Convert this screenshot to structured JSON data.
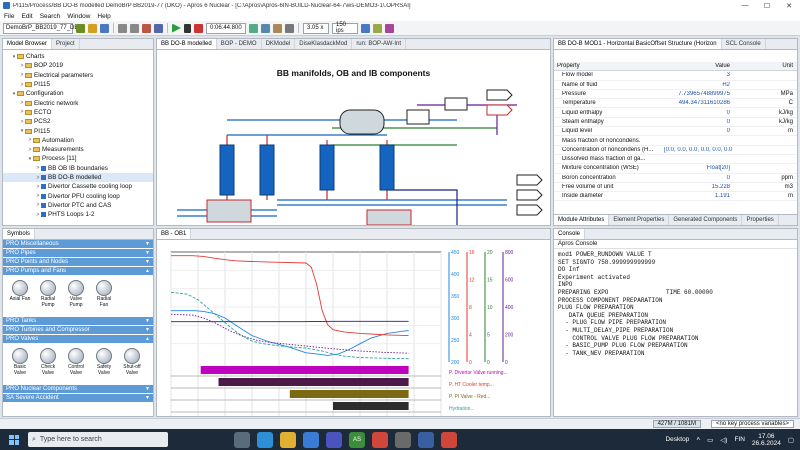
{
  "window": {
    "title": "PI115/Process/BB DO-B modelled DemoBrP BB2019-77 (DKO) - Apros 6 Nuclear - [C:\\Apros\\Apros-6IN-BUILD-Nuclear-64-7\\ws-DEMO3-1\\.OPRSAI]",
    "min": "—",
    "max": "☐",
    "close": "✕"
  },
  "menu": [
    "File",
    "Edit",
    "Search",
    "Window",
    "Help"
  ],
  "toolbar": {
    "model_combo": "DemoBrP_BB2019_77_DE",
    "sim_time": "0:06:44.800",
    "speed": "3.05 x",
    "fps": "150 ips"
  },
  "model_browser": {
    "tabs": [
      "Model Browser",
      "Project"
    ],
    "rows": [
      {
        "indent": 1,
        "tw": "▾",
        "icon": "folder",
        "label": "Charts"
      },
      {
        "indent": 2,
        "tw": ">",
        "icon": "folder",
        "label": "BOP 2019"
      },
      {
        "indent": 2,
        "tw": ">",
        "icon": "folder",
        "label": "Electrical parameters"
      },
      {
        "indent": 2,
        "tw": ">",
        "icon": "folder",
        "label": "PI115"
      },
      {
        "indent": 1,
        "tw": "▾",
        "icon": "folder",
        "label": "Configuration"
      },
      {
        "indent": 2,
        "tw": ">",
        "icon": "folder",
        "label": "Electric network"
      },
      {
        "indent": 2,
        "tw": ">",
        "icon": "folder",
        "label": "ECTO"
      },
      {
        "indent": 2,
        "tw": ">",
        "icon": "folder",
        "label": "PCS2"
      },
      {
        "indent": 2,
        "tw": "▾",
        "icon": "folder",
        "label": "PI115"
      },
      {
        "indent": 3,
        "tw": ">",
        "icon": "folder",
        "label": "Automation"
      },
      {
        "indent": 3,
        "tw": ">",
        "icon": "folder",
        "label": "Measurements"
      },
      {
        "indent": 3,
        "tw": "▾",
        "icon": "folder",
        "label": "Process [11]"
      },
      {
        "indent": 4,
        "tw": ">",
        "icon": "square",
        "label": "BB OB IB boundaries"
      },
      {
        "indent": 4,
        "tw": ">",
        "icon": "square",
        "label": "BB DO-B modelled"
      },
      {
        "indent": 4,
        "tw": ">",
        "icon": "square",
        "label": "Divertor Cassette cooling loop"
      },
      {
        "indent": 4,
        "tw": ">",
        "icon": "square",
        "label": "Divertor PFU cooling loop"
      },
      {
        "indent": 4,
        "tw": ">",
        "icon": "square",
        "label": "Divertor PTC and CAS"
      },
      {
        "indent": 4,
        "tw": ">",
        "icon": "square",
        "label": "PHTS Loops 1-2"
      }
    ]
  },
  "symbols": {
    "title": "Symbols",
    "groups": [
      {
        "label": "PRO Miscellaneous",
        "expanded": false
      },
      {
        "label": "PRO Pipes",
        "expanded": false
      },
      {
        "label": "PRO Points and Nodes",
        "expanded": false
      },
      {
        "label": "PRO Pumps and Fans",
        "expanded": true,
        "items": [
          "Axial Fan",
          "Radial Pump",
          "Valve Pump",
          "Radial Fan"
        ]
      },
      {
        "label": "PRO Tanks",
        "expanded": false
      },
      {
        "label": "PRO Turbines and Compressor",
        "expanded": false
      },
      {
        "label": "PRO Valves",
        "expanded": true,
        "items": [
          "Basic Valve",
          "Check Valve",
          "Control Valve",
          "Safety Valve",
          "Shut-off Valve"
        ]
      },
      {
        "label": "PRO Nuclear Components",
        "expanded": false
      },
      {
        "label": "SA Severe Accident",
        "expanded": false
      }
    ]
  },
  "editor": {
    "tabs": [
      "BB DO-B modelled",
      "BOP - DEMO",
      "DKModel",
      "DiseKlasdackMod",
      "run: BOP-AW-Int"
    ],
    "diagram_title": "BB manifolds, OB and IB components"
  },
  "chart_panel": {
    "tab": "BB - OB1",
    "chart_data": {
      "type": "line",
      "x_ticks": [
        "00:00",
        "00:50",
        "01:40",
        "02:30",
        "03:20",
        "04:10",
        "05:00",
        "05:50",
        "06:40",
        "07:30",
        "08:20"
      ],
      "xlim": [
        0,
        500
      ],
      "series": [
        {
          "color": "#1e88e5",
          "values": [
            [
              0,
              330
            ],
            [
              25,
              330
            ],
            [
              45,
              330
            ],
            [
              60,
              328
            ],
            [
              80,
              322
            ],
            [
              100,
              310
            ],
            [
              120,
              290
            ],
            [
              150,
              262
            ],
            [
              180,
              246
            ],
            [
              200,
              238
            ],
            [
              220,
              230
            ],
            [
              250,
              215
            ],
            [
              270,
              212
            ],
            [
              290,
              208
            ],
            [
              310,
              212
            ],
            [
              330,
              224
            ],
            [
              350,
              240
            ],
            [
              370,
              255
            ],
            [
              400,
              268
            ],
            [
              430,
              274
            ],
            [
              440,
              276
            ]
          ]
        },
        {
          "color": "#e53935",
          "values": [
            [
              0,
              480
            ],
            [
              40,
              480
            ],
            [
              60,
              478
            ],
            [
              80,
              473
            ],
            [
              100,
              469
            ],
            [
              120,
              466
            ],
            [
              150,
              464
            ],
            [
              200,
              462
            ],
            [
              250,
              460
            ],
            [
              260,
              448
            ],
            [
              270,
              400
            ],
            [
              280,
              330
            ],
            [
              290,
              292
            ],
            [
              300,
              278
            ],
            [
              320,
              272
            ],
            [
              350,
              268
            ],
            [
              400,
              264
            ],
            [
              440,
              262
            ]
          ]
        },
        {
          "color": "#26a69a",
          "values": [
            [
              0,
              380
            ],
            [
              30,
              375
            ],
            [
              50,
              360
            ],
            [
              70,
              335
            ],
            [
              90,
              310
            ],
            [
              110,
              285
            ],
            [
              130,
              262
            ],
            [
              150,
              247
            ],
            [
              170,
              240
            ],
            [
              200,
              234
            ],
            [
              250,
              228
            ],
            [
              280,
              220
            ],
            [
              300,
              212
            ],
            [
              320,
              206
            ],
            [
              350,
              202
            ],
            [
              400,
              200
            ],
            [
              440,
              199
            ]
          ]
        },
        {
          "color": "#6a1b9a",
          "values": [
            [
              0,
              320
            ],
            [
              40,
              318
            ],
            [
              60,
              310
            ],
            [
              80,
              298
            ],
            [
              100,
              282
            ],
            [
              120,
              268
            ],
            [
              140,
              257
            ],
            [
              160,
              249
            ],
            [
              180,
              244
            ],
            [
              220,
              238
            ],
            [
              260,
              232
            ],
            [
              300,
              226
            ],
            [
              350,
              220
            ],
            [
              400,
              216
            ],
            [
              440,
              214
            ]
          ]
        },
        {
          "color": "#1a237e",
          "values": [
            [
              0,
              300
            ],
            [
              60,
              300
            ],
            [
              120,
              300
            ],
            [
              180,
              300
            ],
            [
              240,
              300
            ],
            [
              300,
              301
            ],
            [
              360,
              301
            ],
            [
              400,
              301
            ],
            [
              440,
              301
            ]
          ]
        }
      ],
      "bars": [
        {
          "color": "#c000c0",
          "start": 55,
          "end": 440
        },
        {
          "color": "#4b1a4b",
          "start": 88,
          "end": 440
        },
        {
          "color": "#7a6a14",
          "start": 220,
          "end": 440
        },
        {
          "color": "#2d2d2d",
          "start": 300,
          "end": 440
        }
      ],
      "axes": [
        {
          "color": "#1e88e5",
          "labels": [
            "450",
            "400",
            "350",
            "300",
            "250",
            "200"
          ]
        },
        {
          "color": "#e53935",
          "labels": [
            "16",
            "12",
            "8",
            "4",
            "0"
          ]
        },
        {
          "color": "#2e7d32",
          "labels": [
            "20",
            "15",
            "10",
            "5",
            "0"
          ]
        },
        {
          "color": "#6a1b9a",
          "labels": [
            "800",
            "600",
            "400",
            "200",
            "0"
          ]
        }
      ],
      "legend": [
        {
          "color": "#c000c0",
          "label": "P. Divertor Valve running..."
        },
        {
          "color": "#e53935",
          "label": "P. HT Cooler temp..."
        },
        {
          "color": "#7a6a14",
          "label": "P. PI Valve - Red..."
        },
        {
          "color": "#26a69a",
          "label": "Hydration..."
        }
      ]
    }
  },
  "properties": {
    "tab": "BB DO-B MOD1 - Horizontal BasicOffset Structure (Horizon",
    "tab2": "SCL Console",
    "headers": {
      "property": "Property",
      "value": "Value",
      "unit": "Unit"
    },
    "rows": [
      {
        "name": "Flow model",
        "value": "3",
        "unit": ""
      },
      {
        "name": "Name of fluid",
        "value": "H2",
        "unit": ""
      },
      {
        "name": "Pressure",
        "value": "7.73965748899975",
        "unit": "MPa"
      },
      {
        "name": "Temperature",
        "value": "494.347311610286",
        "unit": "C"
      },
      {
        "name": "Liquid enthalpy",
        "value": "0",
        "unit": "kJ/kg"
      },
      {
        "name": "Steam enthalpy",
        "value": "0",
        "unit": "kJ/kg"
      },
      {
        "name": "Liquid level",
        "value": "0",
        "unit": "m"
      },
      {
        "name": "Mass fraction of noncondens.",
        "value": "",
        "unit": ""
      },
      {
        "name": "Concentration of noncondens (H...",
        "value": "[0.0, 0.0, 0.0, 0.0, 0.0, 0.0]",
        "unit": ""
      },
      {
        "name": "Dissolved mass fraction of ga...",
        "value": "",
        "unit": ""
      },
      {
        "name": "Mixture concentration (WSE)",
        "value": "Float[20]",
        "unit": ""
      },
      {
        "name": "Boron concentration",
        "value": "0",
        "unit": "ppm"
      },
      {
        "name": "Free volume of unit",
        "value": "15.228",
        "unit": "m3"
      },
      {
        "name": "Inside diameter",
        "value": "1.191",
        "unit": "m"
      }
    ],
    "bottom_tabs": [
      "Module Attributes",
      "Element Properties",
      "Generated Components",
      "Properties"
    ]
  },
  "console": {
    "tabs": [
      "Console"
    ],
    "title": "Apros Console",
    "lines": [
      "mod1 POWER_RUNDOWN VALUE T",
      "",
      "SET SIGNTO 758.999999999999",
      "",
      "DO Inf",
      "Experiment activated",
      "INPO",
      "PREPARING EXPO                TIME 60.00000",
      "PROCESS COMPONENT PREPARATION",
      "PLUG FLOW PREPARATION",
      "   DATA QUEUE PREPARATION",
      "  - PLUG FLOW PIPE PREPARATION",
      "  - MULTI_DELAY_PIPE PREPARATION",
      "    CONTROL VALVE PLUG FLOW PREPARATION",
      "  - BASIC_PUMP PLUG FLOW PREPARATION",
      "  - TANK_NEV PREPARATION"
    ]
  },
  "statusbar": {
    "memory": "427M / 1081M",
    "hint": "<no key process variables>"
  },
  "taskbar": {
    "search_placeholder": "Type here to search",
    "desktop_label": "Desktop",
    "lang": "FIN",
    "time": "17.06",
    "date": "26.6.2024"
  }
}
